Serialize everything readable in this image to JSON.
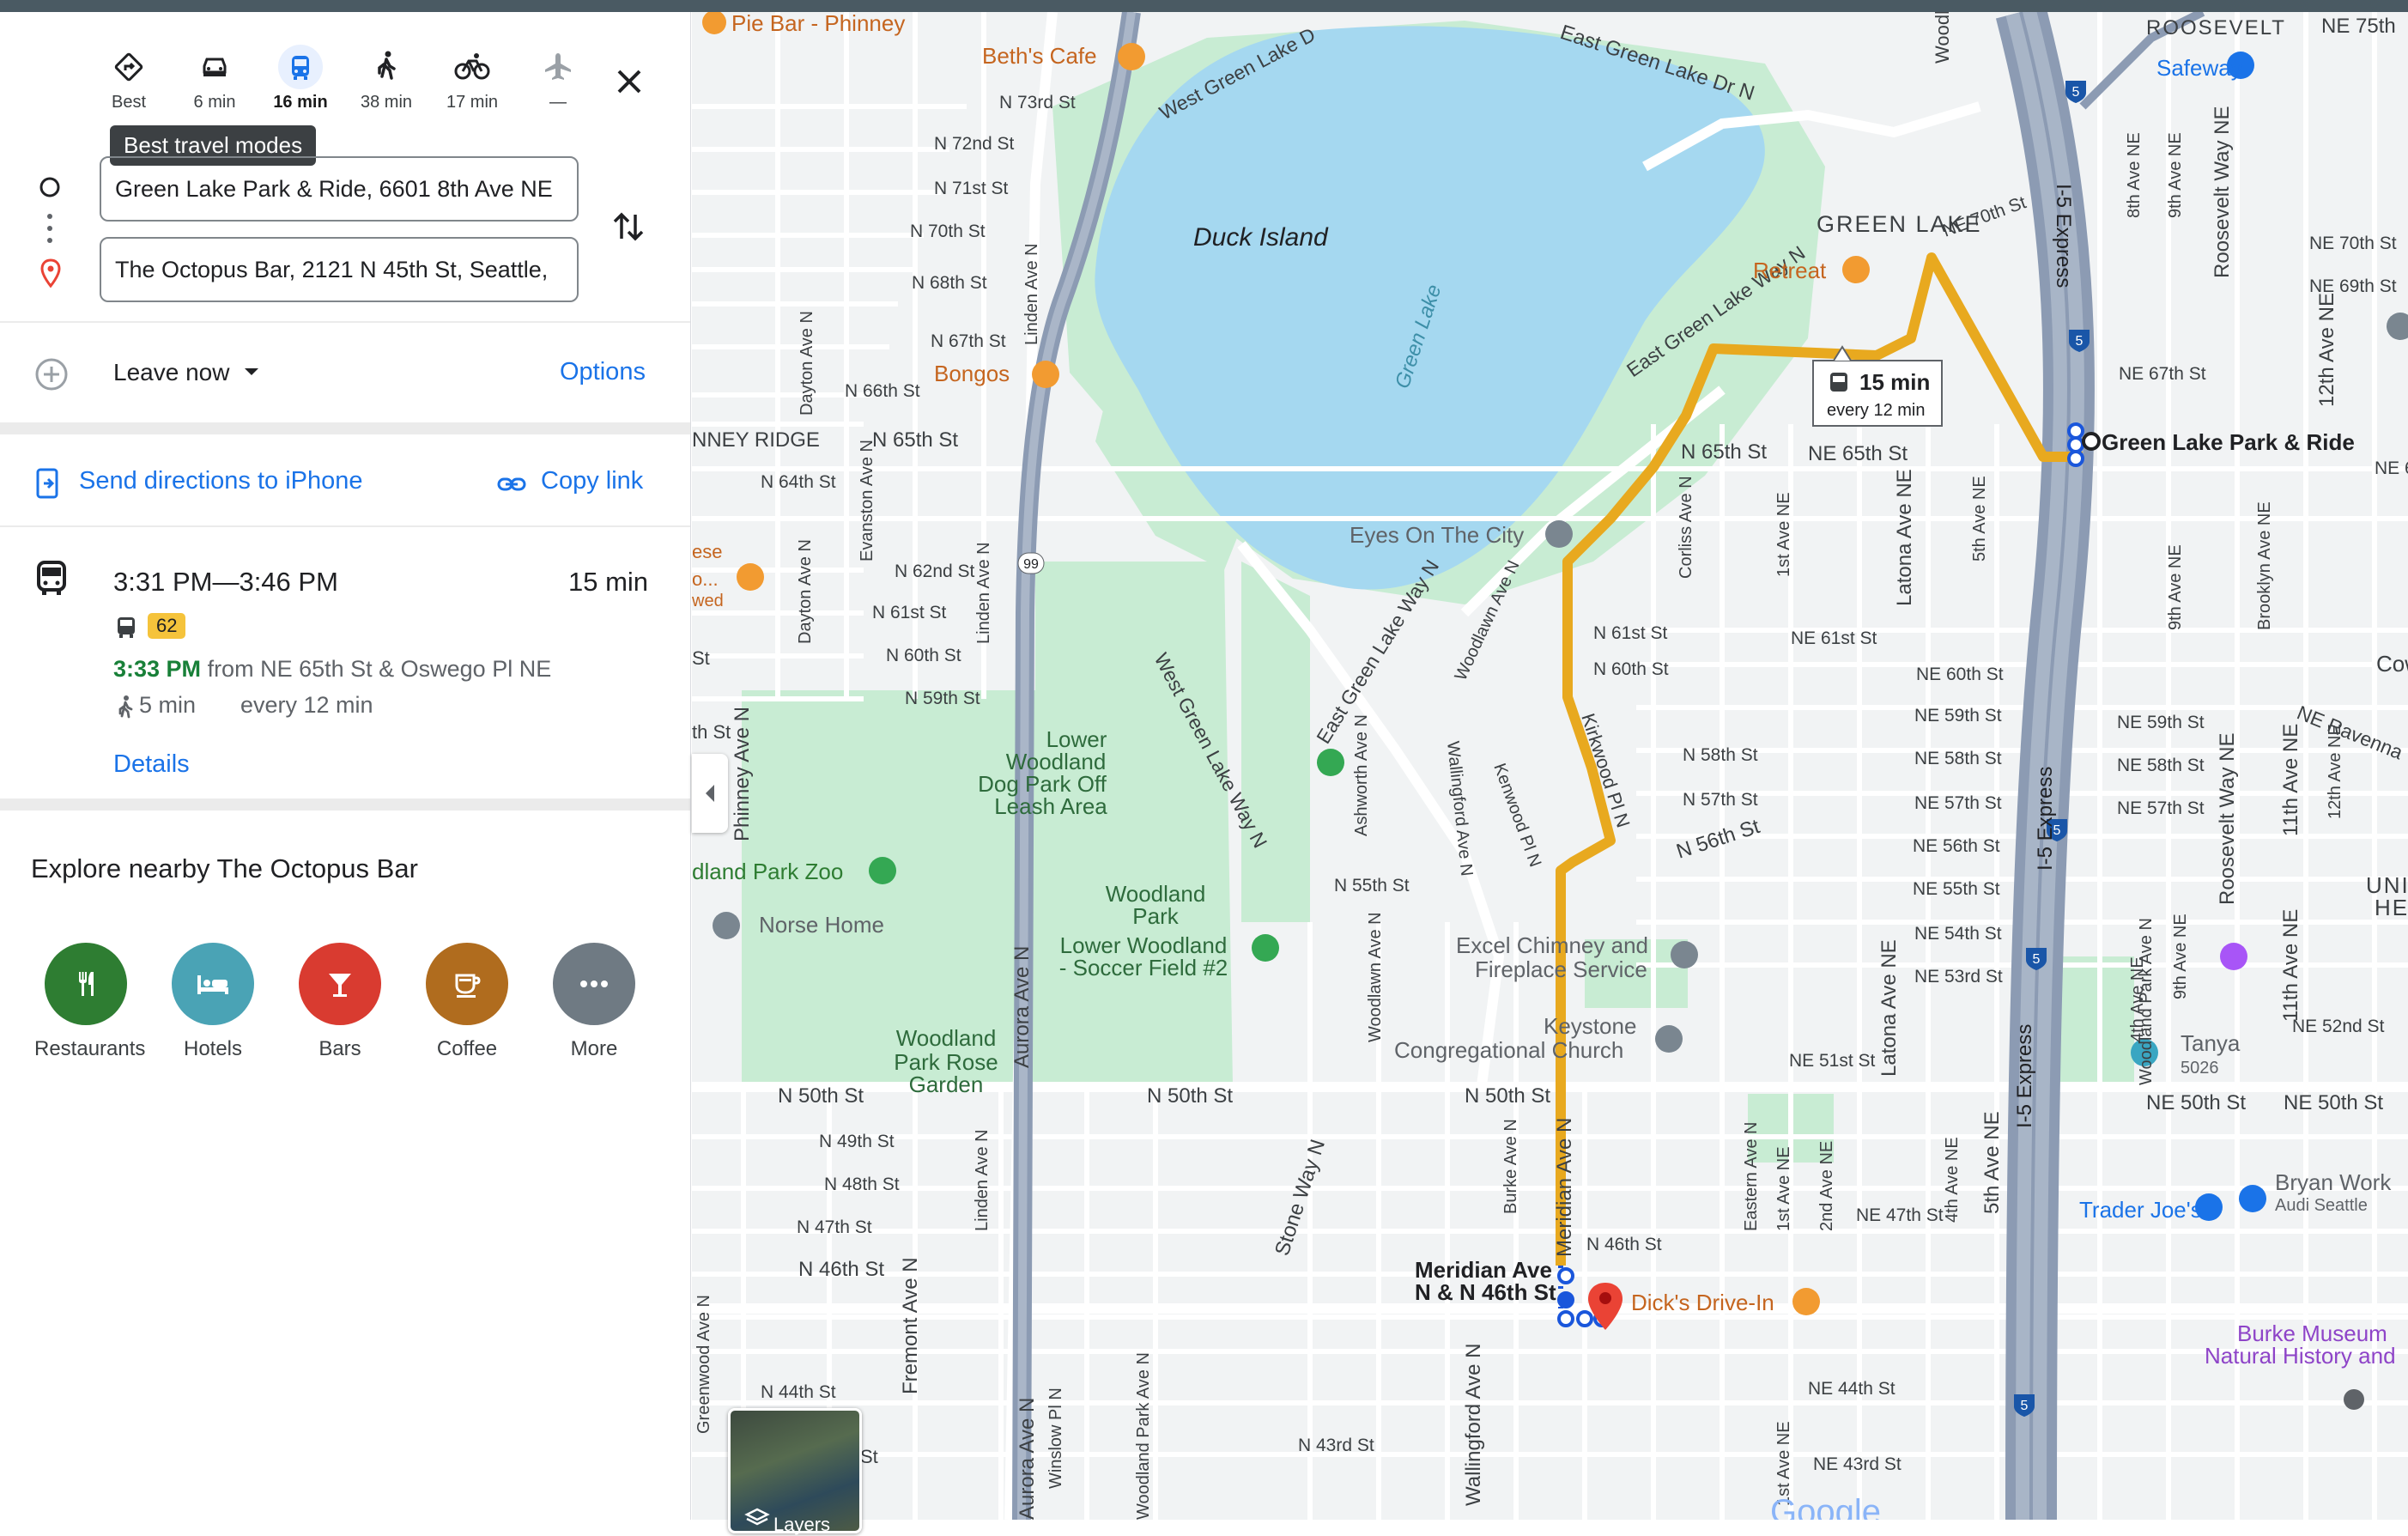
{
  "travel_modes": [
    {
      "icon": "best-route-icon",
      "label": "Best"
    },
    {
      "icon": "car-icon",
      "label": "6 min"
    },
    {
      "icon": "transit-icon",
      "label": "16 min",
      "selected": true
    },
    {
      "icon": "walking-icon",
      "label": "38 min"
    },
    {
      "icon": "bicycle-icon",
      "label": "17 min"
    },
    {
      "icon": "flight-icon",
      "label": "—"
    }
  ],
  "tooltip": "Best travel modes",
  "origin_value": "Green Lake Park & Ride, 6601 8th Ave NE",
  "destination_value": "The Octopus Bar, 2121 N 45th St, Seattle,",
  "leave_now": "Leave now",
  "options": "Options",
  "send_directions": "Send directions to iPhone",
  "copy_link": "Copy link",
  "route": {
    "time_range": "3:31 PM—3:46 PM",
    "duration": "15 min",
    "bus_number": "62",
    "depart_time": "3:33 PM",
    "depart_from": "from NE 65th St & Oswego Pl NE",
    "walk": "5 min",
    "frequency": "every 12 min",
    "details": "Details"
  },
  "explore_title": "Explore nearby The Octopus Bar",
  "categories": [
    {
      "label": "Restaurants",
      "icon": "restaurant-icon",
      "color": "#2e7d32"
    },
    {
      "label": "Hotels",
      "icon": "hotel-icon",
      "color": "#4aa3b5"
    },
    {
      "label": "Bars",
      "icon": "bar-icon",
      "color": "#d93b30"
    },
    {
      "label": "Coffee",
      "icon": "coffee-icon",
      "color": "#b06c1e"
    },
    {
      "label": "More",
      "icon": "more-icon",
      "color": "#6f7a83"
    }
  ],
  "colors": {
    "accent": "#1a73e8",
    "route": "#e8a91f",
    "water": "#a5d8f0",
    "park": "#c8ecd3",
    "transit_time": "#188038",
    "bus_badge": "#f5c33b"
  },
  "map": {
    "route_callout_time": "15 min",
    "route_callout_freq": "every 12 min",
    "layers_label": "Layers",
    "streets": [
      {
        "t": "N 73rd St"
      },
      {
        "t": "N 72nd St"
      },
      {
        "t": "N 71st St"
      },
      {
        "t": "N 70th St"
      },
      {
        "t": "N 68th St"
      },
      {
        "t": "N 67th St"
      },
      {
        "t": "N 66th St"
      },
      {
        "t": "N 65th St"
      },
      {
        "t": "NNEY RIDGE"
      },
      {
        "t": "N 64th St"
      },
      {
        "t": "N 62nd St"
      },
      {
        "t": "N 61st St"
      },
      {
        "t": "N 60th St"
      },
      {
        "t": "N 59th St"
      },
      {
        "t": "N 50th St"
      },
      {
        "t": "N 49th St"
      },
      {
        "t": "N 48th St"
      },
      {
        "t": "N 47th St"
      },
      {
        "t": "N 46th St"
      },
      {
        "t": "N 44th St"
      },
      {
        "t": "N 43rd St"
      },
      {
        "t": "N 55th St"
      },
      {
        "t": "N 50th St"
      },
      {
        "t": "N 50th St"
      },
      {
        "t": "N 46th St"
      },
      {
        "t": "N 61st St"
      },
      {
        "t": "N 60th St"
      },
      {
        "t": "N 58th St"
      },
      {
        "t": "N 57th St"
      },
      {
        "t": "N 56th St"
      },
      {
        "t": "N 65th St"
      },
      {
        "t": "NE 65th St"
      },
      {
        "t": "NE 61st St"
      },
      {
        "t": "NE 60th St"
      },
      {
        "t": "NE 59th St"
      },
      {
        "t": "NE 58th St"
      },
      {
        "t": "NE 57th St"
      },
      {
        "t": "NE 56th St"
      },
      {
        "t": "NE 55th St"
      },
      {
        "t": "NE 54th St"
      },
      {
        "t": "NE 53rd St"
      },
      {
        "t": "NE 51st St"
      },
      {
        "t": "NE 50th St"
      },
      {
        "t": "NE 50th St"
      },
      {
        "t": "NE 47th St"
      },
      {
        "t": "NE 44th St"
      },
      {
        "t": "NE 43rd St"
      },
      {
        "t": "NE 70th St"
      },
      {
        "t": "NE 67th St"
      },
      {
        "t": "NE 70th St"
      },
      {
        "t": "NE 69th St"
      },
      {
        "t": "NE 59th St"
      },
      {
        "t": "NE 58th St"
      },
      {
        "t": "NE 57th St"
      },
      {
        "t": "NE 52nd St"
      },
      {
        "t": "NE 65t"
      },
      {
        "t": "East Green Lake Dr N"
      },
      {
        "t": "West Green Lake D"
      },
      {
        "t": "East Green Lake Way N"
      },
      {
        "t": "West Green Lake Way N"
      },
      {
        "t": "East Green Lake Way N"
      },
      {
        "t": "NE Ravenna"
      },
      {
        "t": "Kirkwood Pl N"
      }
    ],
    "avenues": [
      {
        "t": "Linden Ave N"
      },
      {
        "t": "Dayton Ave N"
      },
      {
        "t": "Evanston Ave N"
      },
      {
        "t": "Linden Ave N"
      },
      {
        "t": "Dayton Ave N"
      },
      {
        "t": "Phinney Ave N"
      },
      {
        "t": "Aurora Ave N"
      },
      {
        "t": "Linden Ave N"
      },
      {
        "t": "Greenwood Ave N"
      },
      {
        "t": "Fremont Ave N"
      },
      {
        "t": "Aurora Ave N"
      },
      {
        "t": "Winslow Pl N"
      },
      {
        "t": "Woodland Park Ave N"
      },
      {
        "t": "Stone Way N"
      },
      {
        "t": "Wallingford Ave N"
      },
      {
        "t": "Burke Ave N"
      },
      {
        "t": "Meridian Ave N"
      },
      {
        "t": "Ashworth Ave N"
      },
      {
        "t": "Woodlawn Ave N"
      },
      {
        "t": "Wallingford Ave N"
      },
      {
        "t": "Kenwood Pl N"
      },
      {
        "t": "Woodlawn Ave N"
      },
      {
        "t": "Corliss Ave N"
      },
      {
        "t": "1st Ave NE"
      },
      {
        "t": "Latona Ave NE"
      },
      {
        "t": "5th Ave NE"
      },
      {
        "t": "Latona Ave NE"
      },
      {
        "t": "Eastern Ave N"
      },
      {
        "t": "1st Ave NE"
      },
      {
        "t": "2nd Ave NE"
      },
      {
        "t": "4th Ave NE"
      },
      {
        "t": "5th Ave NE"
      },
      {
        "t": "1st Ave NE"
      },
      {
        "t": "I-5 Express"
      },
      {
        "t": "I-5 Express"
      },
      {
        "t": "I-5 Express"
      },
      {
        "t": "8th Ave NE"
      },
      {
        "t": "9th Ave NE"
      },
      {
        "t": "Roosevelt Way NE"
      },
      {
        "t": "12th Ave NE"
      },
      {
        "t": "9th Ave NE"
      },
      {
        "t": "Brooklyn Ave NE"
      },
      {
        "t": "Roosevelt Way NE"
      },
      {
        "t": "11th Ave NE"
      },
      {
        "t": "12th Ave NE"
      },
      {
        "t": "11th Ave NE"
      },
      {
        "t": "Woodlawn Ave NE"
      },
      {
        "t": "4th Ave NE"
      },
      {
        "t": "Woodland Park Ave N"
      },
      {
        "t": "9th Ave NE"
      }
    ],
    "places": [
      {
        "t": "Pie Bar - Phinney",
        "kind": "food"
      },
      {
        "t": "Beth's Cafe",
        "kind": "food"
      },
      {
        "t": "Bongos",
        "kind": "food"
      },
      {
        "t": "Retreat",
        "kind": "coffee"
      },
      {
        "t": "Dick's Drive-In",
        "kind": "food"
      },
      {
        "t": "Safeway",
        "kind": "shop"
      },
      {
        "t": "Trader Joe's",
        "kind": "shop"
      },
      {
        "t": "Eyes On The City",
        "kind": "poi"
      },
      {
        "t": "Excel Chimney and",
        "kind": "poi"
      },
      {
        "t": "Fireplace Service",
        "kind": "poi"
      },
      {
        "t": "Keystone",
        "kind": "poi"
      },
      {
        "t": "Congregational Church",
        "kind": "poi"
      },
      {
        "t": "Norse Home",
        "kind": "poi"
      },
      {
        "t": "dland Park Zoo",
        "kind": "park"
      },
      {
        "t": "Bryan Work",
        "kind": "poi"
      },
      {
        "t": "Audi Seattle",
        "kind": "poi"
      },
      {
        "t": "Tanya",
        "kind": "poi"
      },
      {
        "t": "5026",
        "kind": "poi"
      },
      {
        "t": "Burke Museum",
        "kind": "museum"
      },
      {
        "t": "Natural History and",
        "kind": "museum"
      },
      {
        "t": "ese",
        "kind": "food"
      },
      {
        "t": "o...",
        "kind": "food"
      },
      {
        "t": "wed",
        "kind": "food"
      }
    ],
    "areas": [
      {
        "t": "Duck Island"
      },
      {
        "t": "Green Lake"
      },
      {
        "t": "GREEN LAKE"
      },
      {
        "t": "ROOSEVELT"
      },
      {
        "t": "NE 75th"
      },
      {
        "t": "UNIVER"
      },
      {
        "t": "HEIGH"
      },
      {
        "t": "Cowe"
      }
    ],
    "parks": [
      {
        "t": "Lower"
      },
      {
        "t": "Woodland"
      },
      {
        "t": "Dog Park Off"
      },
      {
        "t": "Leash Area"
      },
      {
        "t": "Woodland"
      },
      {
        "t": "Park"
      },
      {
        "t": "Lower Woodland"
      },
      {
        "t": "- Soccer Field #2"
      },
      {
        "t": "Woodland"
      },
      {
        "t": "Park Rose"
      },
      {
        "t": "Garden"
      }
    ],
    "stops": [
      {
        "t": "Green Lake Park & Ride"
      },
      {
        "t": "Meridian Ave"
      },
      {
        "t": "N & N 46th St"
      }
    ],
    "shields": [
      "99",
      "5",
      "5",
      "5",
      "5",
      "5"
    ],
    "small_labels": [
      "th St",
      "St",
      "St",
      "Google"
    ]
  }
}
